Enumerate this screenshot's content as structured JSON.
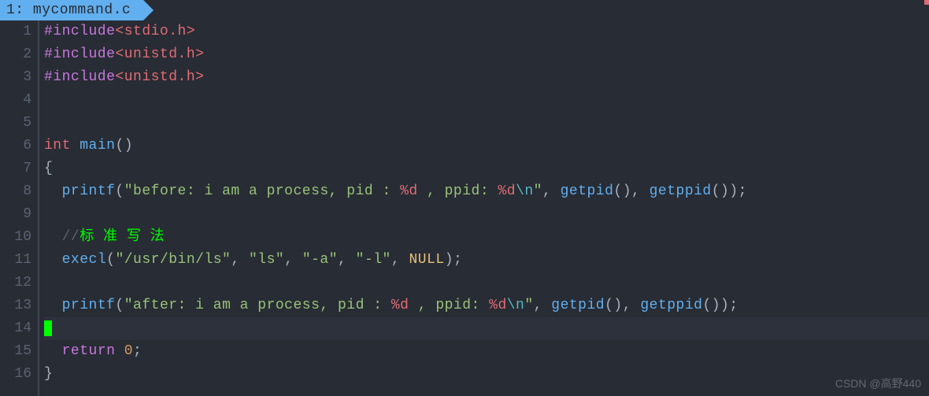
{
  "tab": {
    "label": "1: mycommand.c"
  },
  "lines": {
    "l1": {
      "include": "#include",
      "header": "<stdio.h>"
    },
    "l2": {
      "include": "#include",
      "header": "<unistd.h>"
    },
    "l3": {
      "include": "#include",
      "header": "<unistd.h>"
    },
    "l6": {
      "kw": "int",
      "fn": "main",
      "paren": "()"
    },
    "l7": {
      "brace": "{"
    },
    "l8": {
      "indent": "  ",
      "fn": "printf",
      "open": "(",
      "q1": "\"",
      "s1": "before: i am a process, pid : ",
      "esc1": "%d",
      "s2": " , ppid: ",
      "esc2": "%d",
      "esc3": "\\n",
      "q2": "\"",
      "c1": ", ",
      "f2": "getpid",
      "p2": "()",
      "c2": ", ",
      "f3": "getppid",
      "p3": "());"
    },
    "l10": {
      "indent": "  ",
      "slashes": "//",
      "text": "标 准 写 法"
    },
    "l11": {
      "indent": "  ",
      "fn": "execl",
      "open": "(",
      "arg1": "\"/usr/bin/ls\"",
      "c1": ", ",
      "arg2": "\"ls\"",
      "c2": ", ",
      "arg3": "\"-a\"",
      "c3": ", ",
      "arg4": "\"-l\"",
      "c4": ", ",
      "null": "NULL",
      "close": ");"
    },
    "l13": {
      "indent": "  ",
      "fn": "printf",
      "open": "(",
      "q1": "\"",
      "s1": "after: i am a process, pid : ",
      "esc1": "%d",
      "s2": " , ppid: ",
      "esc2": "%d",
      "esc3": "\\n",
      "q2": "\"",
      "c1": ", ",
      "f2": "getpid",
      "p2": "()",
      "c2": ", ",
      "f3": "getppid",
      "p3": "());"
    },
    "l15": {
      "indent": "  ",
      "kw": "return",
      "sp": " ",
      "num": "0",
      "semi": ";"
    },
    "l16": {
      "brace": "}"
    }
  },
  "gutter": [
    "1",
    "2",
    "3",
    "4",
    "5",
    "6",
    "7",
    "8",
    "9",
    "10",
    "11",
    "12",
    "13",
    "14",
    "15",
    "16"
  ],
  "watermark": "CSDN @高野440"
}
